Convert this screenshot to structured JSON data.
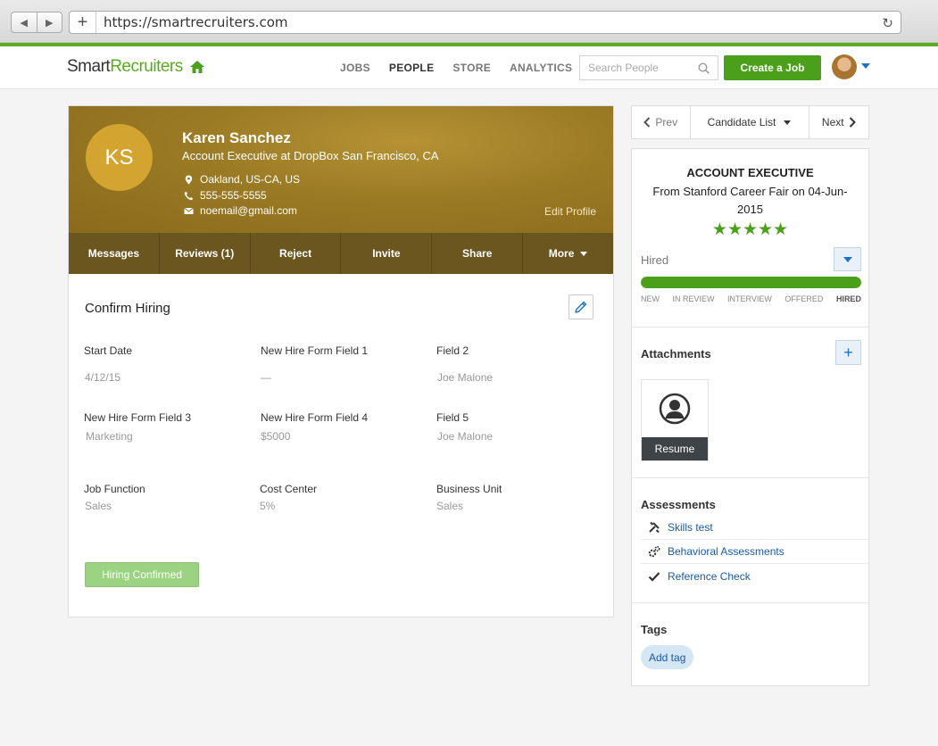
{
  "browser": {
    "url": "https://smartrecruiters.com"
  },
  "header": {
    "logo_part1": "Smart",
    "logo_part2": "Recruiters",
    "nav": [
      "JOBS",
      "PEOPLE",
      "STORE",
      "ANALYTICS"
    ],
    "active_nav": "PEOPLE",
    "search_placeholder": "Search People",
    "create_job_label": "Create a Job"
  },
  "candidate": {
    "initials": "KS",
    "name": "Karen Sanchez",
    "title": "Account Executive at DropBox San Francisco, CA",
    "location": "Oakland, US-CA, US",
    "phone": "555-555-5555",
    "email": "noemail@gmail.com",
    "edit_profile_label": "Edit Profile",
    "accent_color": "#9a7a24"
  },
  "actions": [
    {
      "label": "Messages"
    },
    {
      "label": "Reviews (1)"
    },
    {
      "label": "Reject"
    },
    {
      "label": "Invite"
    },
    {
      "label": "Share"
    },
    {
      "label": "More"
    }
  ],
  "hiring": {
    "section_title": "Confirm Hiring",
    "fields": [
      {
        "label": "Start Date",
        "value": "4/12/15"
      },
      {
        "label": "New Hire Form Field 1",
        "value": "—"
      },
      {
        "label": "Field 2",
        "value": "Joe Malone"
      },
      {
        "label": "New Hire Form Field 3",
        "value": "Marketing"
      },
      {
        "label": "New Hire Form Field 4",
        "value": "$5000"
      },
      {
        "label": "Field 5",
        "value": "Joe Malone"
      },
      {
        "label": "Job Function",
        "value": "Sales"
      },
      {
        "label": "Cost Center",
        "value": "5%"
      },
      {
        "label": "Business Unit",
        "value": "Sales"
      }
    ],
    "confirmed_label": "Hiring Confirmed"
  },
  "pager": {
    "prev": "Prev",
    "list": "Candidate List",
    "next": "Next"
  },
  "job": {
    "title": "ACCOUNT EXECUTIVE",
    "source": "From Stanford Career Fair on 04-Jun-2015",
    "stars": "★★★★★",
    "rating": 5,
    "status": "Hired",
    "progress_fraction": 1.0,
    "stages": [
      "NEW",
      "IN REVIEW",
      "INTERVIEW",
      "OFFERED",
      "HIRED"
    ],
    "current_stage": "HIRED"
  },
  "attachments": {
    "title": "Attachments",
    "items": [
      {
        "label": "Resume",
        "icon": "person-circle-icon"
      }
    ]
  },
  "assessments": {
    "title": "Assessments",
    "items": [
      {
        "label": "Skills test",
        "icon": "tools-icon"
      },
      {
        "label": "Behavioral Assessments",
        "icon": "gears-icon"
      },
      {
        "label": "Reference Check",
        "icon": "check-icon"
      }
    ]
  },
  "tags": {
    "title": "Tags",
    "add_label": "Add tag"
  }
}
